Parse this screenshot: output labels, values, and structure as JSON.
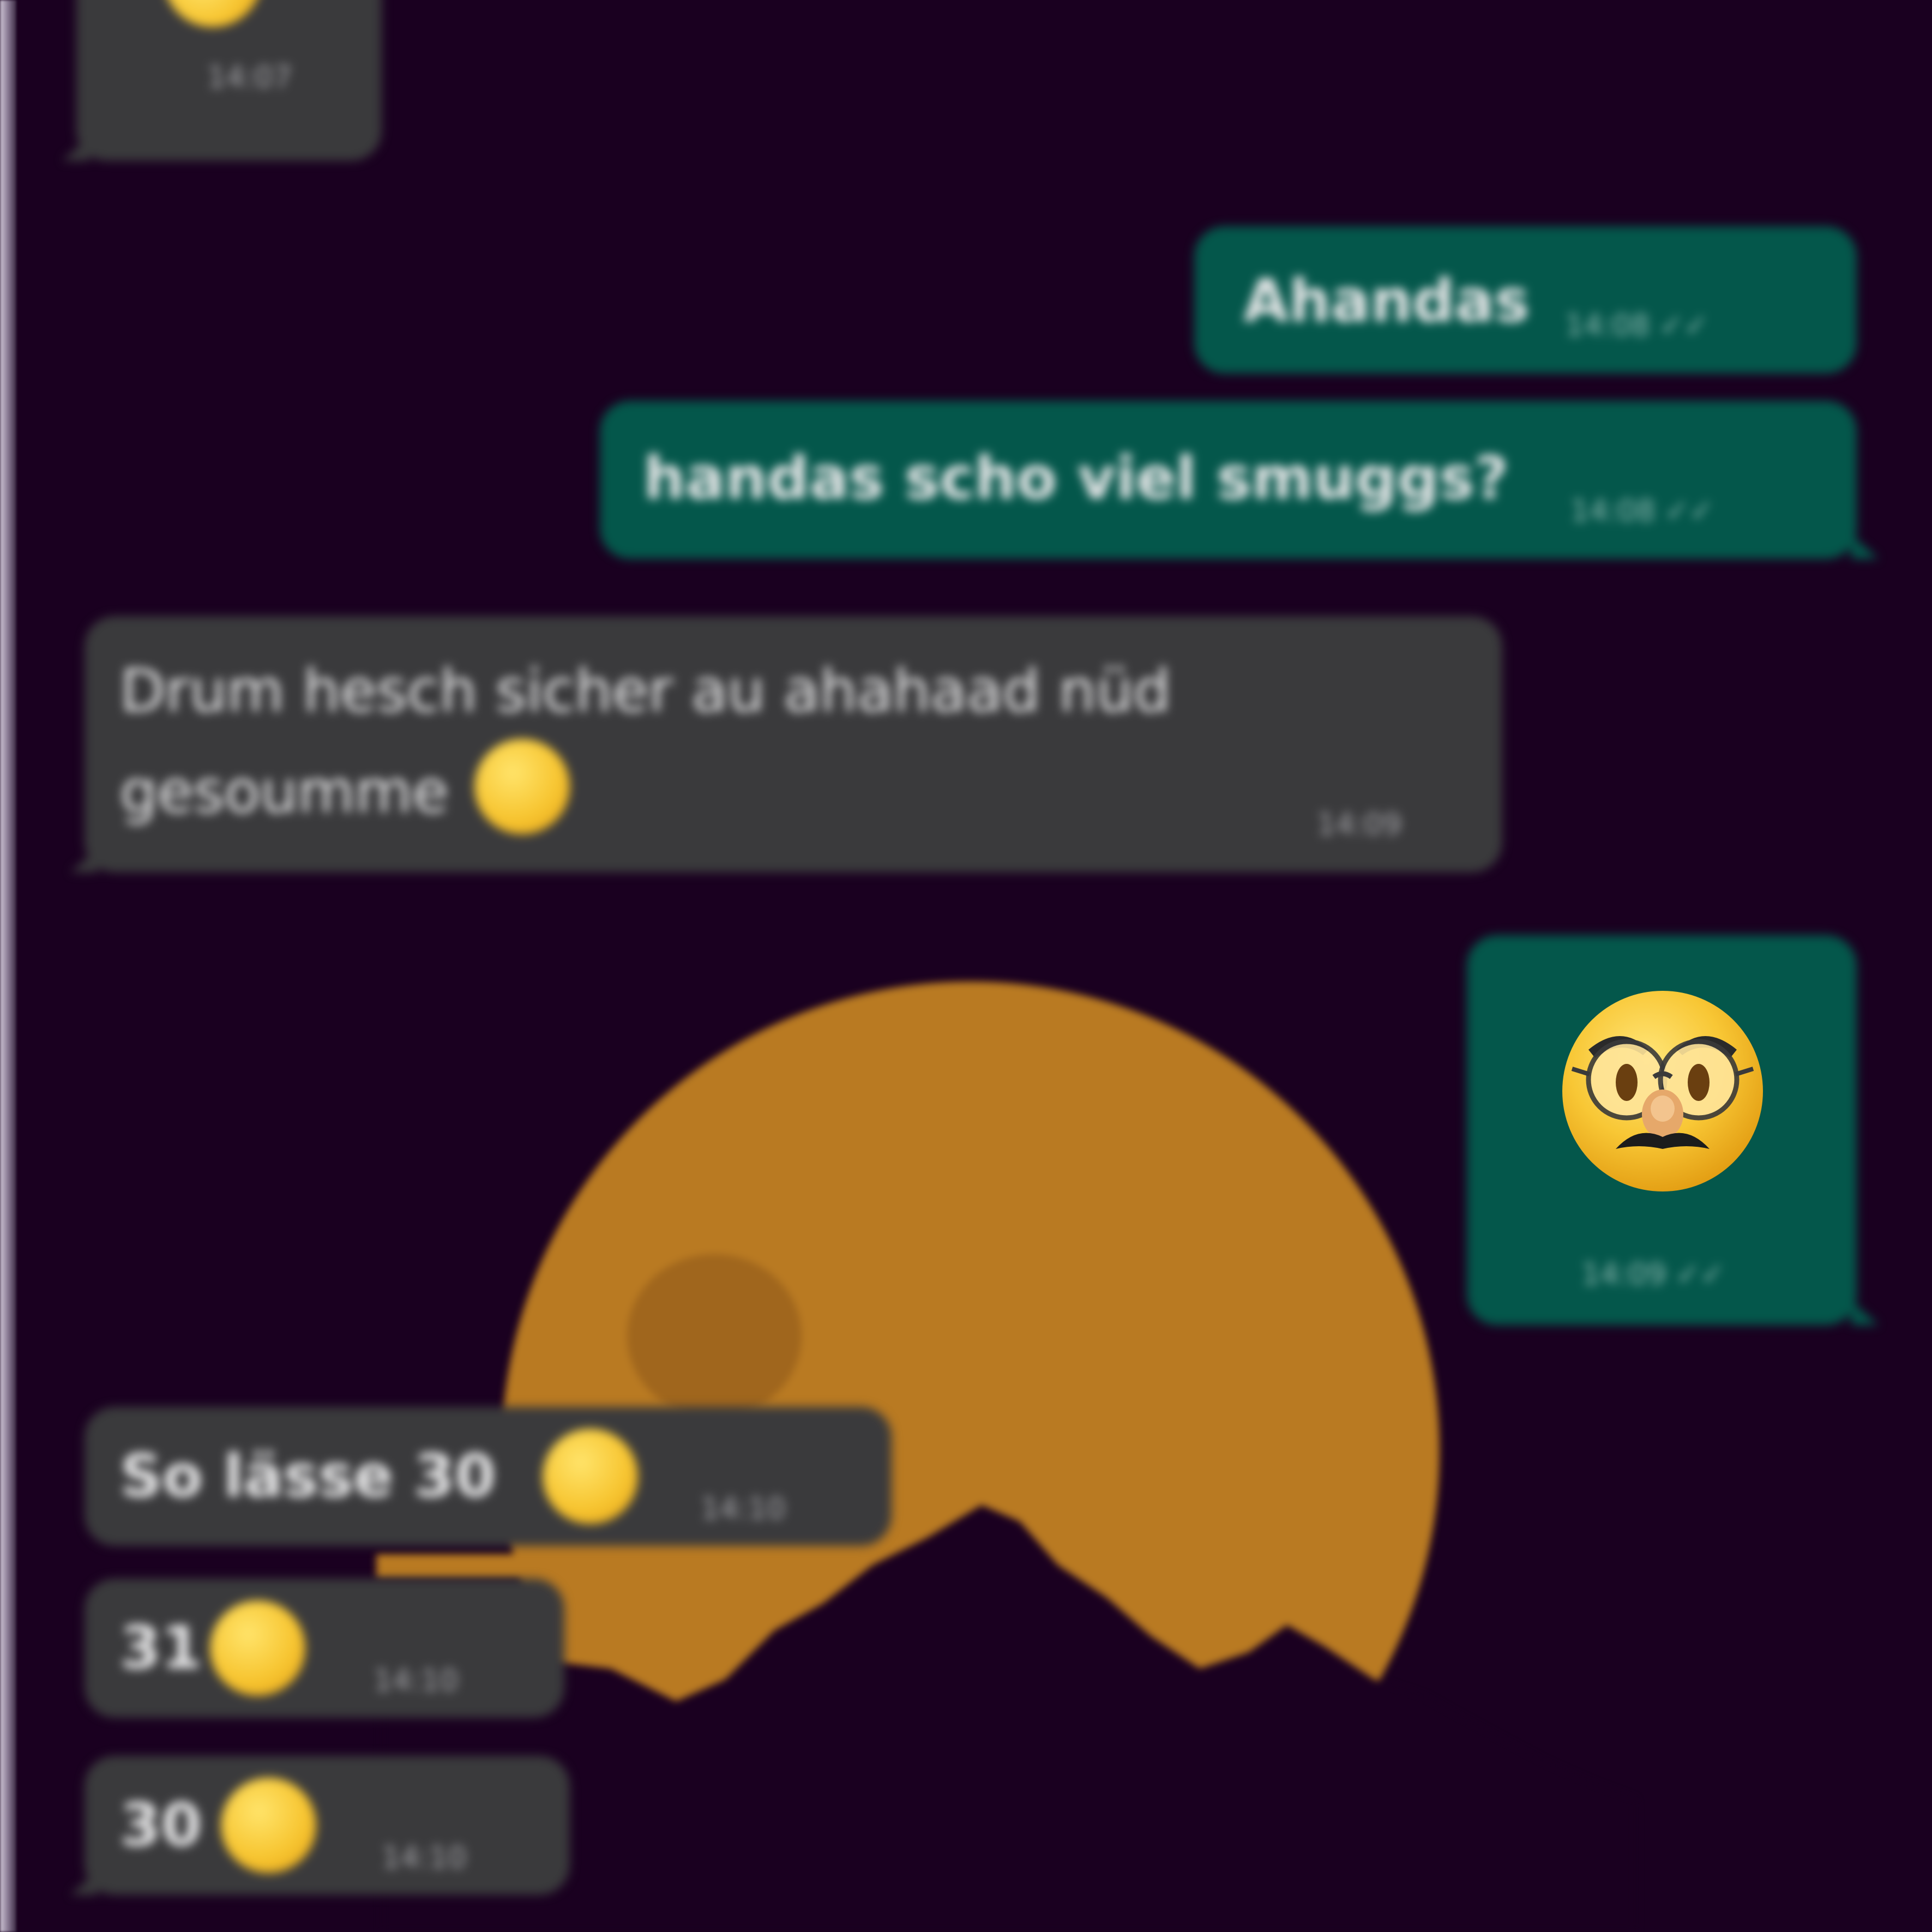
{
  "chat": {
    "messages": [
      {
        "direction": "incoming",
        "text": "",
        "time": "14:07"
      },
      {
        "direction": "outgoing",
        "text": "Ahandas",
        "time": "14:08 ✓✓"
      },
      {
        "direction": "outgoing",
        "text": "handas scho viel smuggs?",
        "time": "14:08 ✓✓"
      },
      {
        "direction": "incoming",
        "text": "Drum hesch sicher au ahahaad nüd",
        "text_line2": "gesoumme",
        "time": "14:09"
      },
      {
        "direction": "outgoing",
        "text": "",
        "time": "14:09 ✓✓"
      },
      {
        "direction": "incoming",
        "text": "So lässe 30",
        "time": "14:10"
      },
      {
        "direction": "incoming",
        "text": "31",
        "time": "14:10"
      },
      {
        "direction": "incoming",
        "text": "30",
        "time": "14:10"
      }
    ]
  },
  "icons": {
    "big_emoji": "disguised-face-emoji",
    "inline_emoji": "grinning-face-emoji"
  },
  "colors": {
    "background": "#1a0020",
    "incoming_bubble": "#3a3a3c",
    "outgoing_bubble": "#04574b",
    "wallpaper_sun": "#b97a22"
  }
}
